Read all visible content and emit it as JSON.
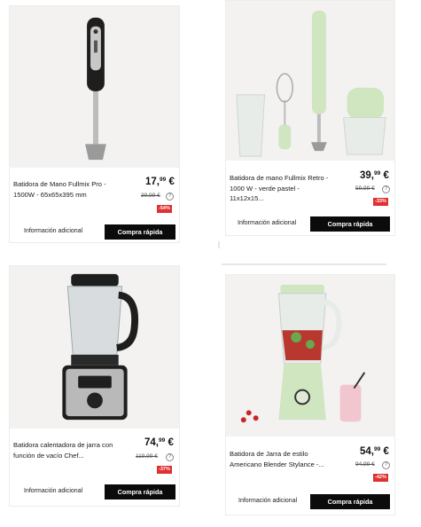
{
  "products": [
    {
      "name": "Batidora de Mano Fullmix Pro - 1500W - 65x65x395 mm",
      "price_int": "17,",
      "price_dec": "99",
      "currency": "€",
      "old_price": "39,99 €",
      "discount": "-54%",
      "more_label": "Información adicional",
      "buy_label": "Compra rápida",
      "image_icon": "hand-blender-icon"
    },
    {
      "name": "Batidora de mano Fullmix Retro - 1000 W - verde pastel - 11x12x15...",
      "price_int": "39,",
      "price_dec": "99",
      "currency": "€",
      "old_price": "59,99 €",
      "discount": "-33%",
      "more_label": "Información adicional",
      "buy_label": "Compra rápida",
      "image_icon": "hand-blender-set-icon"
    },
    {
      "name": "Batidora calentadora de jarra con función de vacío Chef...",
      "price_int": "74,",
      "price_dec": "99",
      "currency": "€",
      "old_price": "119,99 €",
      "discount": "-37%",
      "more_label": "Información adicional",
      "buy_label": "Compra rápida",
      "image_icon": "heated-jug-blender-icon"
    },
    {
      "name": "Batidora de Jarra de estilo Americano Blender Stylance -...",
      "price_int": "54,",
      "price_dec": "99",
      "currency": "€",
      "old_price": "94,99 €",
      "discount": "-42%",
      "more_label": "Información adicional",
      "buy_label": "Compra rápida",
      "image_icon": "jug-blender-icon"
    }
  ],
  "info_glyph": "?",
  "colors": {
    "buy_button": "#0b0b0b",
    "discount": "#e03131",
    "image_bg": "#f3f2f1",
    "mint": "#cfe6c0"
  }
}
